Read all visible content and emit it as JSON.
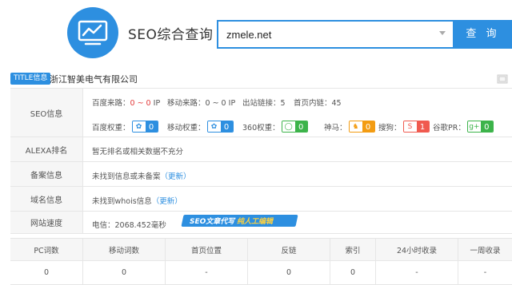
{
  "header": {
    "site_title": "SEO综合查询",
    "search_value": "zmele.net",
    "search_button": "查 询"
  },
  "title_row": {
    "badge": "TITLE信息",
    "company": "浙江智美电气有限公司"
  },
  "seo_row": {
    "label": "SEO信息",
    "baidu_source_label": "百度来路：",
    "baidu_source_value": "0 ~ 0",
    "baidu_source_unit": "IP",
    "mobile_source_label": "移动来路：",
    "mobile_source_value": "0 ~ 0",
    "mobile_source_unit": "IP",
    "outlinks_label": "出站链接：",
    "outlinks_value": "5",
    "inlinks_label": "首页内链：",
    "inlinks_value": "45",
    "weights": [
      {
        "label": "百度权重：",
        "value": "0",
        "icon": "paw-icon",
        "color": "#2d8fe0"
      },
      {
        "label": "移动权重：",
        "value": "0",
        "icon": "paw-icon",
        "color": "#2d8fe0"
      },
      {
        "label": "360权重：",
        "value": "0",
        "icon": "360-icon",
        "color": "#3cb34a"
      },
      {
        "label": "神马：",
        "value": "0",
        "icon": "shenma-icon",
        "color": "#f39c12"
      },
      {
        "label": "搜狗：",
        "value": "1",
        "icon": "sogou-icon",
        "color": "#f05a4f"
      },
      {
        "label": "谷歌PR：",
        "value": "0",
        "icon": "google-plus-icon",
        "color": "#3cb34a"
      }
    ]
  },
  "alexa_row": {
    "label": "ALEXA排名",
    "value": "暂无排名或相关数据不充分"
  },
  "icp_row": {
    "label": "备案信息",
    "value": "未找到信息或未备案",
    "link": "（更新）"
  },
  "domain_row": {
    "label": "域名信息",
    "value": "未找到whois信息",
    "link": "（更新）"
  },
  "speed_row": {
    "label": "网站速度",
    "value": "电信：2068.452毫秒",
    "ad_text1": "SEO文章代写",
    "ad_text2": "纯人工编辑"
  },
  "stats": {
    "headers": [
      "PC词数",
      "移动词数",
      "首页位置",
      "反链",
      "索引",
      "24小时收录",
      "一周收录"
    ],
    "values": [
      "0",
      "0",
      "-",
      "0",
      "0",
      "-",
      "-"
    ]
  }
}
